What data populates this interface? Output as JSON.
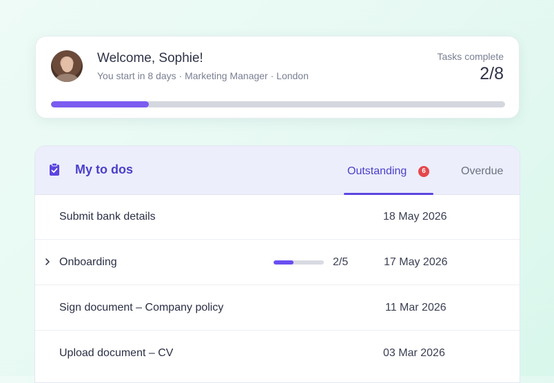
{
  "welcome": {
    "title": "Welcome, Sophie!",
    "subtitle": "You start in 8 days · Marketing Manager · London",
    "tasks_label": "Tasks complete",
    "tasks_count": "2/8",
    "progress_fraction": 0.215
  },
  "todos": {
    "title": "My to dos",
    "tabs": {
      "outstanding": {
        "label": "Outstanding",
        "badge": "6"
      },
      "overdue": {
        "label": "Overdue"
      }
    },
    "rows": [
      {
        "title": "Submit bank details",
        "date": "18 May 2026"
      },
      {
        "title": "Onboarding",
        "date": "17 May 2026",
        "progress_label": "2/5",
        "progress_fraction": 0.4
      },
      {
        "title": "Sign document – Company policy",
        "date": "11 Mar 2026"
      },
      {
        "title": "Upload document – CV",
        "date": "03 Mar 2026"
      }
    ]
  },
  "colors": {
    "accent": "#5b45e0",
    "progress": "#7b5cf0",
    "badge": "#e5484d"
  },
  "icons": [
    "clipboard-check-icon",
    "chevron-right-icon"
  ]
}
